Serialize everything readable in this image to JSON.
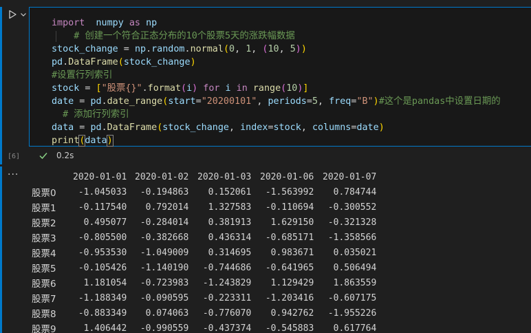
{
  "cell": {
    "execution_count": "[6]",
    "status_time": "0.2s",
    "code_lines": [
      [
        [
          "kw",
          "import"
        ],
        [
          "pl",
          "  "
        ],
        [
          "id",
          "numpy"
        ],
        [
          "pl",
          " "
        ],
        [
          "kw",
          "as"
        ],
        [
          "pl",
          " "
        ],
        [
          "id",
          "np"
        ]
      ],
      [
        [
          "pl",
          "    "
        ],
        [
          "cmt",
          "# 创建一个符合正态分布的10个股票5天的涨跌幅数据"
        ]
      ],
      [
        [
          "id",
          "stock_change"
        ],
        [
          "pl",
          " = "
        ],
        [
          "id",
          "np"
        ],
        [
          "pl",
          "."
        ],
        [
          "id",
          "random"
        ],
        [
          "pl",
          "."
        ],
        [
          "fn",
          "normal"
        ],
        [
          "br1",
          "("
        ],
        [
          "num",
          "0"
        ],
        [
          "pl",
          ", "
        ],
        [
          "num",
          "1"
        ],
        [
          "pl",
          ", "
        ],
        [
          "br2",
          "("
        ],
        [
          "num",
          "10"
        ],
        [
          "pl",
          ", "
        ],
        [
          "num",
          "5"
        ],
        [
          "br2",
          ")"
        ],
        [
          "br1",
          ")"
        ]
      ],
      [
        [
          "id",
          "pd"
        ],
        [
          "pl",
          "."
        ],
        [
          "fn",
          "DataFrame"
        ],
        [
          "br1",
          "("
        ],
        [
          "id",
          "stock_change"
        ],
        [
          "br1",
          ")"
        ]
      ],
      [
        [
          "cmt",
          "#设置行列索引"
        ]
      ],
      [
        [
          "id",
          "stock"
        ],
        [
          "pl",
          " = "
        ],
        [
          "br1",
          "["
        ],
        [
          "str",
          "\"股票{}\""
        ],
        [
          "pl",
          "."
        ],
        [
          "fn",
          "format"
        ],
        [
          "br2",
          "("
        ],
        [
          "id",
          "i"
        ],
        [
          "br2",
          ")"
        ],
        [
          "pl",
          " "
        ],
        [
          "kw",
          "for"
        ],
        [
          "pl",
          " "
        ],
        [
          "id",
          "i"
        ],
        [
          "pl",
          " "
        ],
        [
          "kw",
          "in"
        ],
        [
          "pl",
          " "
        ],
        [
          "fn",
          "range"
        ],
        [
          "br2",
          "("
        ],
        [
          "num",
          "10"
        ],
        [
          "br2",
          ")"
        ],
        [
          "br1",
          "]"
        ]
      ],
      [
        [
          "id",
          "date"
        ],
        [
          "pl",
          " = "
        ],
        [
          "id",
          "pd"
        ],
        [
          "pl",
          "."
        ],
        [
          "fn",
          "date_range"
        ],
        [
          "br1",
          "("
        ],
        [
          "id",
          "start"
        ],
        [
          "pl",
          "="
        ],
        [
          "str",
          "\"20200101\""
        ],
        [
          "pl",
          ", "
        ],
        [
          "id",
          "periods"
        ],
        [
          "pl",
          "="
        ],
        [
          "num",
          "5"
        ],
        [
          "pl",
          ", "
        ],
        [
          "id",
          "freq"
        ],
        [
          "pl",
          "="
        ],
        [
          "str",
          "\"B\""
        ],
        [
          "br1",
          ")"
        ],
        [
          "cmt",
          "#这个是pandas中设置日期的"
        ]
      ],
      [
        [
          "pl",
          "  "
        ],
        [
          "cmt",
          "# 添加行列索引"
        ]
      ],
      [
        [
          "id",
          "data"
        ],
        [
          "pl",
          " = "
        ],
        [
          "id",
          "pd"
        ],
        [
          "pl",
          "."
        ],
        [
          "fn",
          "DataFrame"
        ],
        [
          "br1",
          "("
        ],
        [
          "id",
          "stock_change"
        ],
        [
          "pl",
          ", "
        ],
        [
          "id",
          "index"
        ],
        [
          "pl",
          "="
        ],
        [
          "id",
          "stock"
        ],
        [
          "pl",
          ", "
        ],
        [
          "id",
          "columns"
        ],
        [
          "pl",
          "="
        ],
        [
          "id",
          "date"
        ],
        [
          "br1",
          ")"
        ]
      ],
      [
        [
          "fn",
          "print"
        ],
        [
          "br1cur",
          "("
        ],
        [
          "id",
          "data"
        ],
        [
          "br1cur",
          ")"
        ]
      ]
    ]
  },
  "output": {
    "more_label": "···",
    "columns": [
      "2020-01-01",
      "2020-01-02",
      "2020-01-03",
      "2020-01-06",
      "2020-01-07"
    ],
    "rows": [
      {
        "index": "股票0",
        "values": [
          "-1.045033",
          "-0.194863",
          "0.152061",
          "-1.563992",
          "0.784744"
        ]
      },
      {
        "index": "股票1",
        "values": [
          "-0.117540",
          "0.792014",
          "1.327583",
          "-0.110694",
          "-0.300552"
        ]
      },
      {
        "index": "股票2",
        "values": [
          "0.495077",
          "-0.284014",
          "0.381913",
          "1.629150",
          "-0.321328"
        ]
      },
      {
        "index": "股票3",
        "values": [
          "-0.805500",
          "-0.382668",
          "0.436314",
          "-0.685171",
          "-1.358566"
        ]
      },
      {
        "index": "股票4",
        "values": [
          "-0.953530",
          "-1.049009",
          "0.314695",
          "0.983671",
          "0.035021"
        ]
      },
      {
        "index": "股票5",
        "values": [
          "-0.105426",
          "-1.140190",
          "-0.744686",
          "-0.641965",
          "0.506494"
        ]
      },
      {
        "index": "股票6",
        "values": [
          "1.181054",
          "-0.723983",
          "-1.243829",
          "1.129429",
          "1.863559"
        ]
      },
      {
        "index": "股票7",
        "values": [
          "-1.188349",
          "-0.090595",
          "-0.223311",
          "-1.203416",
          "-0.607175"
        ]
      },
      {
        "index": "股票8",
        "values": [
          "-0.883349",
          "0.074063",
          "-0.776070",
          "0.942762",
          "-1.955226"
        ]
      },
      {
        "index": "股票9",
        "values": [
          "1.406442",
          "-0.990559",
          "-0.437374",
          "-0.545883",
          "0.617764"
        ]
      }
    ]
  },
  "colors": {
    "accent": "#007acc",
    "success": "#89d185",
    "background": "#1f1f1f",
    "editor_background": "#181818"
  },
  "icons": {
    "run": "run-cell-icon",
    "run_options": "chevron-down-icon",
    "success": "check-icon",
    "more": "more-actions-icon"
  }
}
